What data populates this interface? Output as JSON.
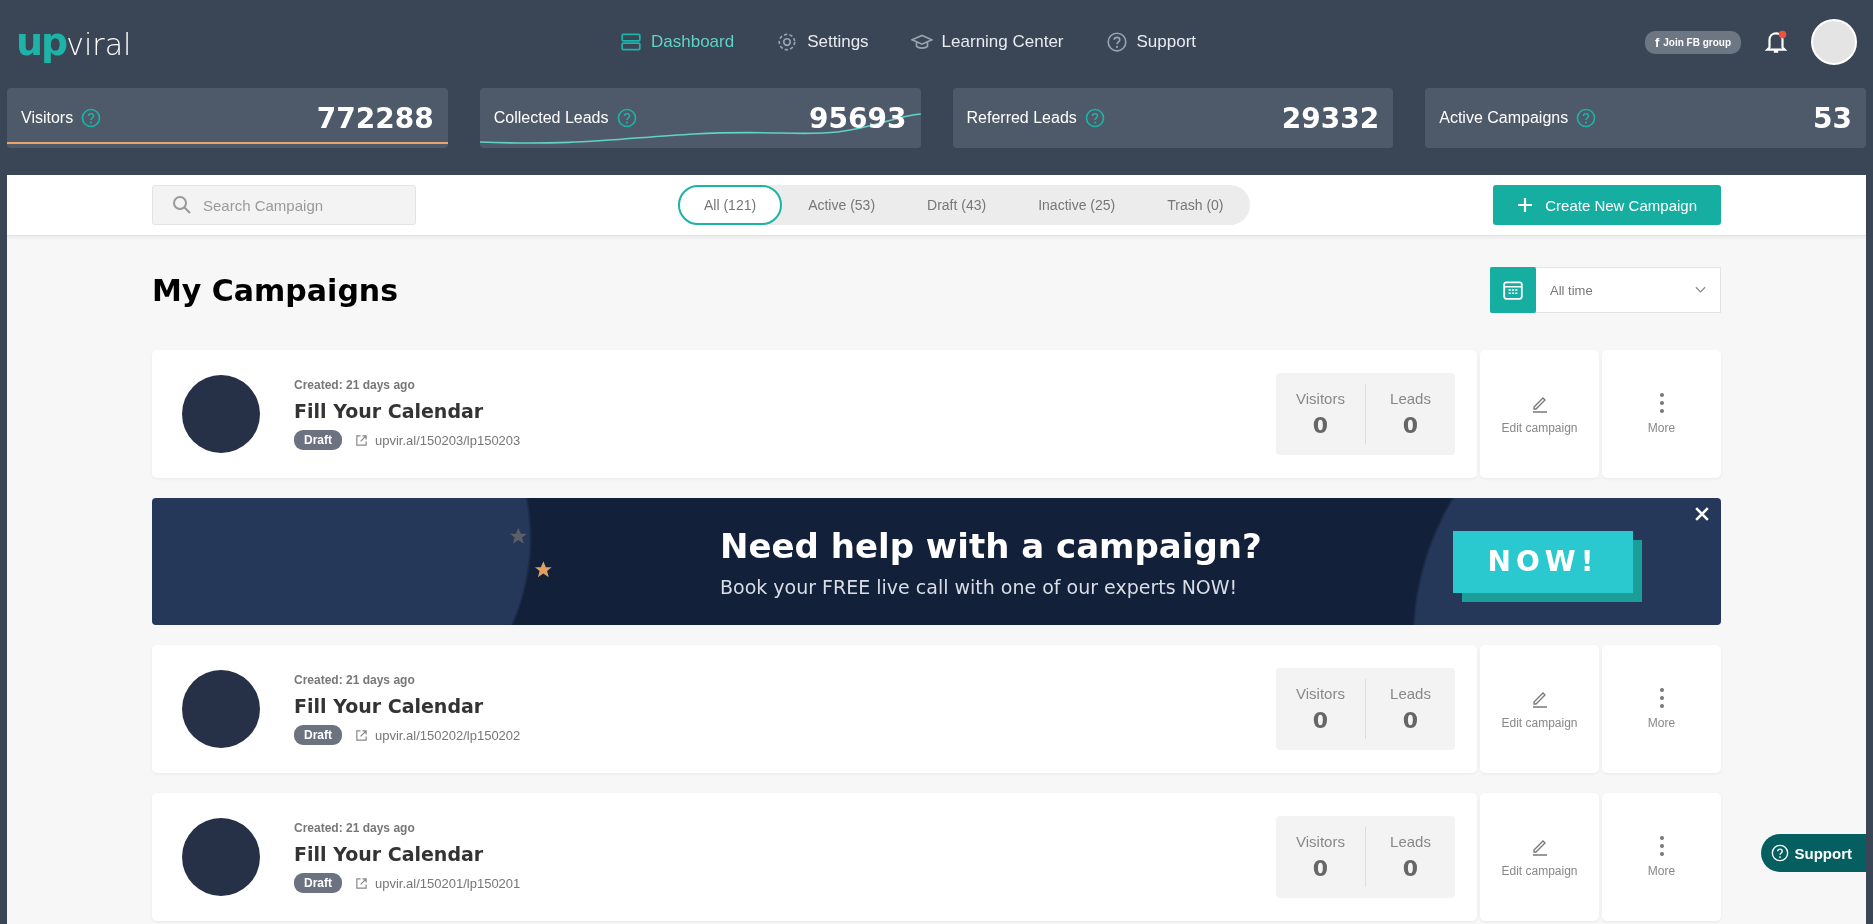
{
  "header": {
    "logo": {
      "accent": "up",
      "rest": "viral"
    },
    "nav": [
      {
        "label": "Dashboard",
        "kind": "dashboard",
        "selected": true
      },
      {
        "label": "Settings",
        "kind": "gear",
        "selected": false
      },
      {
        "label": "Learning Center",
        "kind": "cap",
        "selected": false
      },
      {
        "label": "Support",
        "kind": "help",
        "selected": false
      }
    ],
    "fb_button": {
      "mark": "f",
      "label": "Join FB group"
    },
    "notification_unread": true
  },
  "stats": [
    {
      "label": "Visitors",
      "value": "772288",
      "kind": "baseline"
    },
    {
      "label": "Collected Leads",
      "value": "95693",
      "kind": "sparkline"
    },
    {
      "label": "Referred Leads",
      "value": "29332",
      "kind": "plain"
    },
    {
      "label": "Active Campaigns",
      "value": "53",
      "kind": "plain"
    }
  ],
  "toolbar": {
    "search": {
      "placeholder": "Search Campaign"
    },
    "filters": [
      {
        "label": "All (121)",
        "selected": true
      },
      {
        "label": "Active (53)",
        "selected": false
      },
      {
        "label": "Draft (43)",
        "selected": false
      },
      {
        "label": "Inactive (25)",
        "selected": false
      },
      {
        "label": "Trash (0)",
        "selected": false
      }
    ],
    "create_button": "Create New Campaign"
  },
  "heading": "My Campaigns",
  "date_filter": "All time",
  "feed": [
    {
      "kind": "campaign",
      "created": "Created: 21 days ago",
      "title": "Fill Your Calendar",
      "status": "Draft",
      "link": "upvir.al/150203/lp150203",
      "visitors_label": "Visitors",
      "visitors": "0",
      "leads_label": "Leads",
      "leads": "0",
      "edit": "Edit campaign",
      "more": "More"
    },
    {
      "kind": "banner",
      "title": "Need help with a campaign?",
      "subtitle": "Book your FREE live call with one of our experts NOW!",
      "button": "NOW!"
    },
    {
      "kind": "campaign",
      "created": "Created: 21 days ago",
      "title": "Fill Your Calendar",
      "status": "Draft",
      "link": "upvir.al/150202/lp150202",
      "visitors_label": "Visitors",
      "visitors": "0",
      "leads_label": "Leads",
      "leads": "0",
      "edit": "Edit campaign",
      "more": "More"
    },
    {
      "kind": "campaign",
      "created": "Created: 21 days ago",
      "title": "Fill Your Calendar",
      "status": "Draft",
      "link": "upvir.al/150201/lp150201",
      "visitors_label": "Visitors",
      "visitors": "0",
      "leads_label": "Leads",
      "leads": "0",
      "edit": "Edit campaign",
      "more": "More"
    }
  ],
  "support_button": "Support"
}
